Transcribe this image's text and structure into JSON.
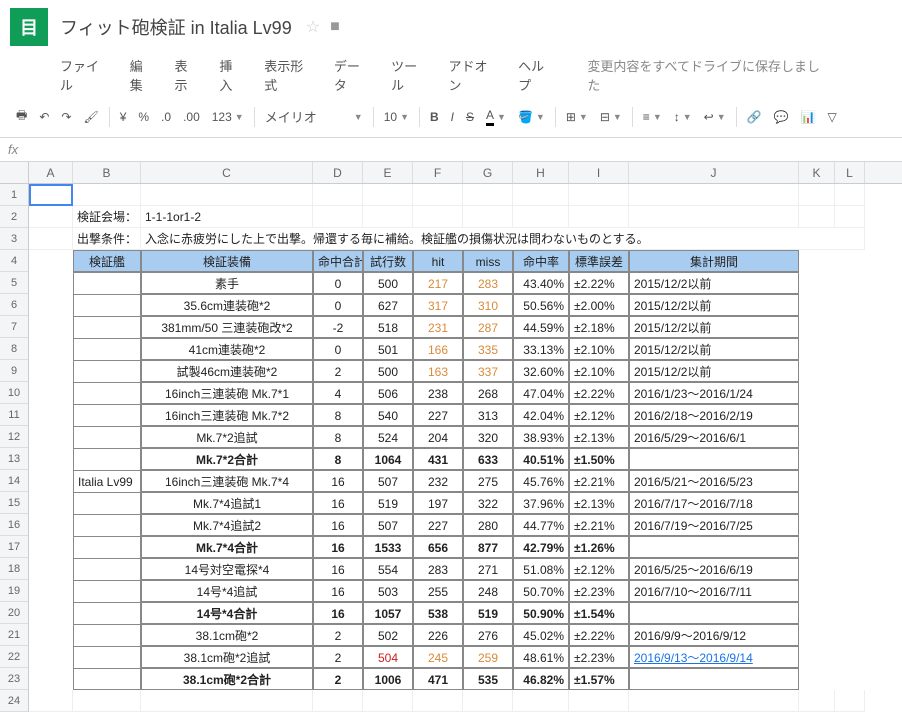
{
  "logo": "目",
  "docTitle": "フィット砲検証 in Italia Lv99",
  "menu": {
    "file": "ファイル",
    "edit": "編集",
    "view": "表示",
    "insert": "挿入",
    "format": "表示形式",
    "data": "データ",
    "tools": "ツール",
    "addons": "アドオン",
    "help": "ヘルプ"
  },
  "saveMsg": "変更内容をすべてドライブに保存しました",
  "toolbar": {
    "yen": "¥",
    "pct": "%",
    "dec0": ".0",
    "dec00": ".00",
    "num": "123",
    "font": "メイリオ",
    "fontSize": "10",
    "bold": "B",
    "italic": "I",
    "strike": "S",
    "under": "A"
  },
  "fx": "fx",
  "cols": [
    "A",
    "B",
    "C",
    "D",
    "E",
    "F",
    "G",
    "H",
    "I",
    "J",
    "K",
    "L"
  ],
  "widths": [
    44,
    68,
    172,
    50,
    50,
    50,
    50,
    56,
    60,
    170,
    36,
    30
  ],
  "info1_lbl": "検証会場：",
  "info1_val": "1-1-1or1-2",
  "info2_lbl": "出撃条件：",
  "info2_val": "入念に赤疲労にした上で出撃。帰還する毎に補給。検証艦の損傷状況は問わないものとする。",
  "hdrs": {
    "ship": "検証艦",
    "equip": "検証装備",
    "hitsum": "命中合計",
    "trials": "試行数",
    "hit": "hit",
    "miss": "miss",
    "rate": "命中率",
    "stderr": "標準誤差",
    "period": "集計期間"
  },
  "ship": "Italia Lv99",
  "rows": [
    {
      "e": "素手",
      "a": "0",
      "t": "500",
      "h": "217",
      "m": "283",
      "r": "43.40%",
      "s": "±2.22%",
      "p": "2015/12/2以前",
      "o": true
    },
    {
      "e": "35.6cm連装砲*2",
      "a": "0",
      "t": "627",
      "h": "317",
      "m": "310",
      "r": "50.56%",
      "s": "±2.00%",
      "p": "2015/12/2以前",
      "o": true
    },
    {
      "e": "381mm/50 三連装砲改*2",
      "a": "-2",
      "t": "518",
      "h": "231",
      "m": "287",
      "r": "44.59%",
      "s": "±2.18%",
      "p": "2015/12/2以前",
      "o": true
    },
    {
      "e": "41cm連装砲*2",
      "a": "0",
      "t": "501",
      "h": "166",
      "m": "335",
      "r": "33.13%",
      "s": "±2.10%",
      "p": "2015/12/2以前",
      "o": true
    },
    {
      "e": "試製46cm連装砲*2",
      "a": "2",
      "t": "500",
      "h": "163",
      "m": "337",
      "r": "32.60%",
      "s": "±2.10%",
      "p": "2015/12/2以前",
      "o": true
    },
    {
      "e": "16inch三連装砲 Mk.7*1",
      "a": "4",
      "t": "506",
      "h": "238",
      "m": "268",
      "r": "47.04%",
      "s": "±2.22%",
      "p": "2016/1/23～2016/1/24"
    },
    {
      "e": "16inch三連装砲 Mk.7*2",
      "a": "8",
      "t": "540",
      "h": "227",
      "m": "313",
      "r": "42.04%",
      "s": "±2.12%",
      "p": "2016/2/18～2016/2/19"
    },
    {
      "e": "Mk.7*2追試",
      "a": "8",
      "t": "524",
      "h": "204",
      "m": "320",
      "r": "38.93%",
      "s": "±2.13%",
      "p": "2016/5/29～2016/6/1"
    },
    {
      "e": "Mk.7*2合計",
      "a": "8",
      "t": "1064",
      "h": "431",
      "m": "633",
      "r": "40.51%",
      "s": "±1.50%",
      "p": "",
      "b": true
    },
    {
      "e": "16inch三連装砲 Mk.7*4",
      "a": "16",
      "t": "507",
      "h": "232",
      "m": "275",
      "r": "45.76%",
      "s": "±2.21%",
      "p": "2016/5/21～2016/5/23"
    },
    {
      "e": "Mk.7*4追試1",
      "a": "16",
      "t": "519",
      "h": "197",
      "m": "322",
      "r": "37.96%",
      "s": "±2.13%",
      "p": "2016/7/17～2016/7/18"
    },
    {
      "e": "Mk.7*4追試2",
      "a": "16",
      "t": "507",
      "h": "227",
      "m": "280",
      "r": "44.77%",
      "s": "±2.21%",
      "p": "2016/7/19～2016/7/25"
    },
    {
      "e": "Mk.7*4合計",
      "a": "16",
      "t": "1533",
      "h": "656",
      "m": "877",
      "r": "42.79%",
      "s": "±1.26%",
      "p": "",
      "b": true
    },
    {
      "e": "14号対空電探*4",
      "a": "16",
      "t": "554",
      "h": "283",
      "m": "271",
      "r": "51.08%",
      "s": "±2.12%",
      "p": "2016/5/25～2016/6/19"
    },
    {
      "e": "14号*4追試",
      "a": "16",
      "t": "503",
      "h": "255",
      "m": "248",
      "r": "50.70%",
      "s": "±2.23%",
      "p": "2016/7/10～2016/7/11"
    },
    {
      "e": "14号*4合計",
      "a": "16",
      "t": "1057",
      "h": "538",
      "m": "519",
      "r": "50.90%",
      "s": "±1.54%",
      "p": "",
      "b": true
    },
    {
      "e": "38.1cm砲*2",
      "a": "2",
      "t": "502",
      "h": "226",
      "m": "276",
      "r": "45.02%",
      "s": "±2.22%",
      "p": "2016/9/9～2016/9/12"
    },
    {
      "e": "38.1cm砲*2追試",
      "a": "2",
      "t": "504",
      "h": "245",
      "m": "259",
      "r": "48.61%",
      "s": "±2.23%",
      "p": "2016/9/13～2016/9/14",
      "o": true,
      "l": true,
      "rt": true
    },
    {
      "e": "38.1cm砲*2合計",
      "a": "2",
      "t": "1006",
      "h": "471",
      "m": "535",
      "r": "46.82%",
      "s": "±1.57%",
      "p": "",
      "b": true
    }
  ]
}
